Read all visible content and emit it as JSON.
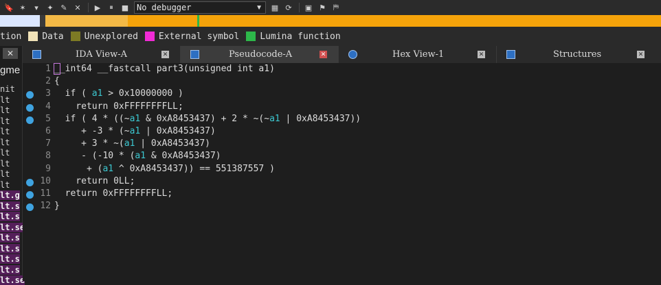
{
  "toolbar": {
    "debugger_select": "No debugger",
    "icons": [
      "bookmark-icon",
      "magic-icon",
      "arrow-down-icon",
      "pin-icon",
      "edit-icon",
      "close-icon",
      "play-icon",
      "pause-icon",
      "stop-icon",
      "graph-icon",
      "refresh-icon",
      "struct-icon",
      "tree-icon",
      "flag-icon"
    ]
  },
  "legend": {
    "items": [
      {
        "label": "tion",
        "color": "#dbe7ff"
      },
      {
        "label": "Data",
        "color": "#f1e3b8"
      },
      {
        "label": "Unexplored",
        "color": "#7d7a24"
      },
      {
        "label": "External symbol",
        "color": "#f12bd6"
      },
      {
        "label": "Lumina function",
        "color": "#2db84a"
      }
    ]
  },
  "left_panel": {
    "title": "gme",
    "close_label": "✕",
    "items": [
      "nit",
      "lt",
      "lt",
      "lt",
      "lt",
      "lt",
      "lt",
      "lt",
      "lt",
      "lt",
      "lt.g",
      "lt.s",
      "lt.s",
      "lt.se",
      "lt.s",
      "lt.s",
      "lt.s",
      "lt.s",
      "lt.se"
    ]
  },
  "tabs": [
    {
      "label": "IDA View-A",
      "active": false
    },
    {
      "label": "Pseudocode-A",
      "active": true
    },
    {
      "label": "Hex View-1",
      "active": false
    },
    {
      "label": "Structures",
      "active": false
    }
  ],
  "code": {
    "line_numbers": [
      "1",
      "2",
      "3",
      "4",
      "5",
      "6",
      "7",
      "8",
      "9",
      "10",
      "11",
      "12"
    ],
    "breakpoints": [
      false,
      false,
      true,
      true,
      true,
      false,
      false,
      false,
      false,
      true,
      true,
      true
    ],
    "lines": [
      [
        [
          "_",
          ""
        ],
        [
          "_int64 __fastcall part3(unsigned int a1)",
          ""
        ]
      ],
      [
        [
          "{",
          ""
        ]
      ],
      [
        [
          "  if ( ",
          ""
        ],
        [
          "a1",
          "var"
        ],
        [
          " > 0x10000000 )",
          ""
        ]
      ],
      [
        [
          "    return 0xFFFFFFFFLL;",
          ""
        ]
      ],
      [
        [
          "  if ( 4 * ((~",
          ""
        ],
        [
          "a1",
          "var"
        ],
        [
          " & 0xA8453437) + 2 * ~(~",
          ""
        ],
        [
          "a1",
          "var"
        ],
        [
          " | 0xA8453437))",
          ""
        ]
      ],
      [
        [
          "     + -3 * (~",
          ""
        ],
        [
          "a1",
          "var"
        ],
        [
          " | 0xA8453437)",
          ""
        ]
      ],
      [
        [
          "     + 3 * ~(",
          ""
        ],
        [
          "a1",
          "var"
        ],
        [
          " | 0xA8453437)",
          ""
        ]
      ],
      [
        [
          "     - (-10 * (",
          ""
        ],
        [
          "a1",
          "var"
        ],
        [
          " & 0xA8453437)",
          ""
        ]
      ],
      [
        [
          "      + (",
          ""
        ],
        [
          "a1",
          "var"
        ],
        [
          " ^ 0xA8453437)) == 551387557 )",
          ""
        ]
      ],
      [
        [
          "    return 0LL;",
          ""
        ]
      ],
      [
        [
          "  return 0xFFFFFFFFLL;",
          ""
        ]
      ],
      [
        [
          "}",
          ""
        ]
      ]
    ]
  }
}
